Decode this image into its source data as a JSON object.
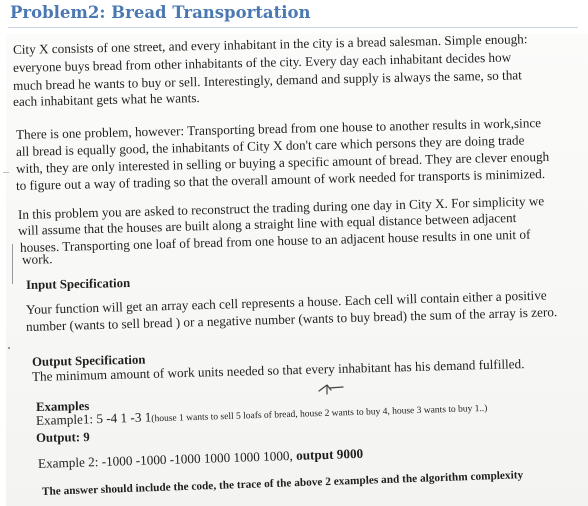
{
  "header": {
    "title": "Problem2: Bread Transportation"
  },
  "paragraph1": {
    "lines": [
      "City X consists of one street, and every inhabitant in the city is a bread salesman. Simple enough:",
      "everyone buys bread  from other inhabitants of the city. Every day each inhabitant decides how",
      "much bread he wants to buy or sell. Interestingly, demand and supply is always the same, so that",
      "each inhabitant gets what he wants."
    ]
  },
  "paragraph2": {
    "lines": [
      "There is one problem, however: Transporting bread from one house to another results in work,since",
      "all bread is equally good, the inhabitants of City X don't care which persons they are doing trade",
      "with, they are only interested in selling or buying a specific amount of bread. They are clever enough",
      "to figure out a way of trading so that the overall amount of work needed for transports is minimized."
    ]
  },
  "paragraph3": {
    "lines": [
      "In this problem you are asked to reconstruct the trading during one day in City X. For simplicity we",
      "will assume that the houses are built along a straight line with equal distance between adjacent",
      "houses. Transporting one loaf of bread from one house to an adjacent house results in one unit of",
      "work."
    ]
  },
  "input_spec": {
    "heading": "Input Specification",
    "lines": [
      "Your function will get an array each cell represents a house. Each cell will contain either a positive",
      "number (wants to sell bread ) or a negative number (wants to buy bread) the sum of the array is zero."
    ]
  },
  "output_spec": {
    "heading": "Output Specification",
    "line": "The minimum amount of work units needed so that every inhabitant has his demand fulfilled."
  },
  "examples": {
    "heading": "Examples",
    "example1_label": "Example1: 5 -4 1 -3 1",
    "example1_note": "(house 1 wants to sell 5 loafs of bread, house 2 wants to buy 4, house 3 wants to buy 1..)",
    "output1": "Output: 9",
    "example2_label": "Example 2: -1000 -1000 -1000 1000 1000 1000,",
    "example2_output": "output 9000"
  },
  "footer": {
    "instruction": "The answer should include the code, the trace of the above 2 examples and the algorithm complexity"
  }
}
